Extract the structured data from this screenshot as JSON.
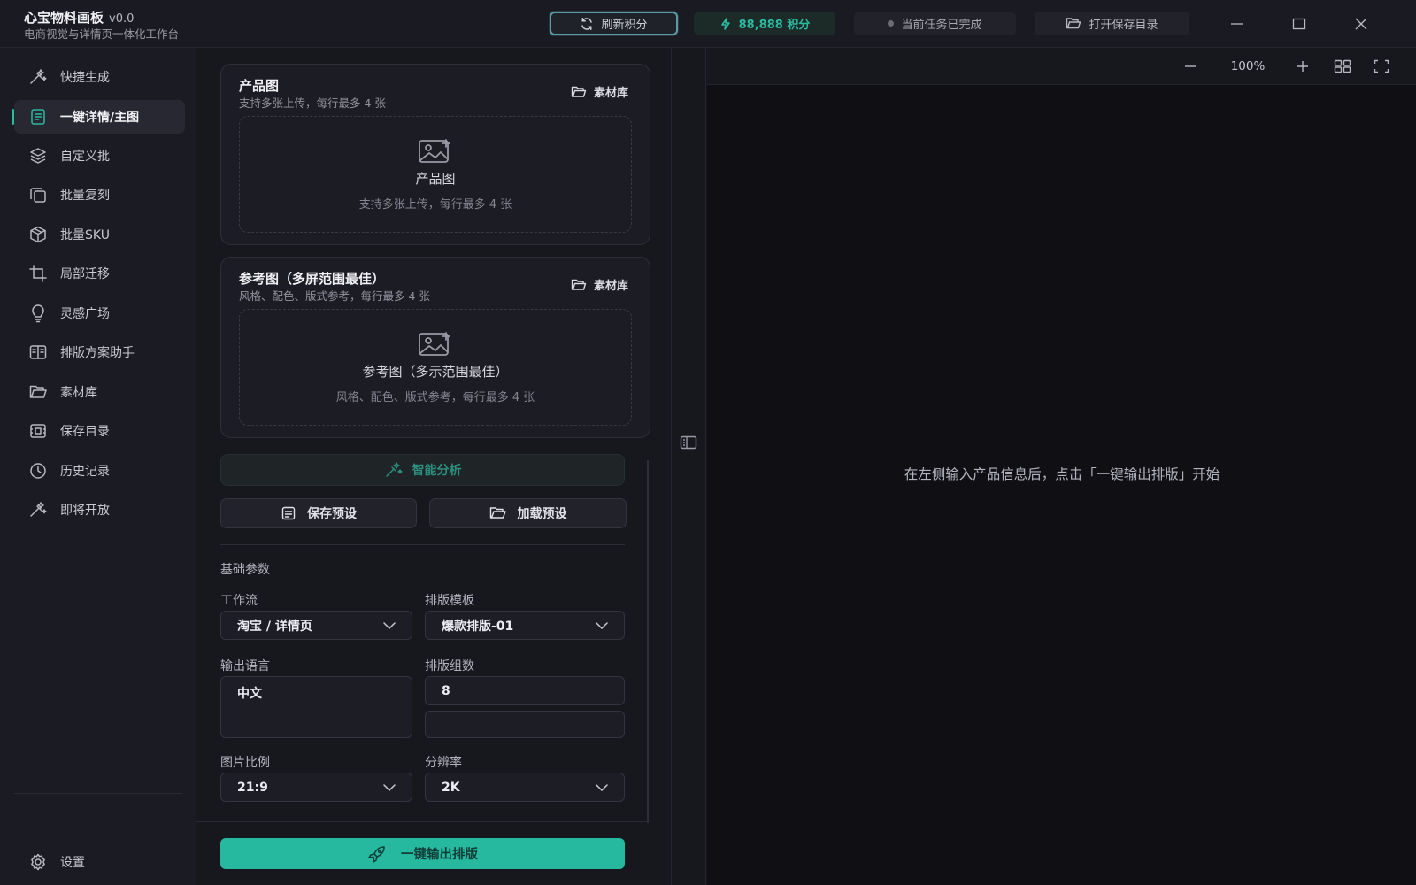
{
  "app": {
    "title": "心宝物料画板",
    "version": "v0.0",
    "subtitle": "电商视觉与详情页一体化工作台"
  },
  "titlebar": {
    "refresh_label": "刷新积分",
    "points_label": "88,888 积分",
    "status_label": "当前任务已完成",
    "open_dir_label": "打开保存目录"
  },
  "sidebar": {
    "items": [
      {
        "label": "快捷生成",
        "icon": "wand-icon"
      },
      {
        "label": "一键详情/主图",
        "icon": "document-icon",
        "active": true
      },
      {
        "label": "自定义批",
        "icon": "layers-icon"
      },
      {
        "label": "批量复刻",
        "icon": "copy-icon"
      },
      {
        "label": "批量SKU",
        "icon": "box-icon"
      },
      {
        "label": "局部迁移",
        "icon": "crop-icon"
      },
      {
        "label": "灵感广场",
        "icon": "lightbulb-icon"
      },
      {
        "label": "排版方案助手",
        "icon": "layout-icon"
      },
      {
        "label": "素材库",
        "icon": "folder-icon"
      },
      {
        "label": "保存目录",
        "icon": "save-dir-icon"
      },
      {
        "label": "历史记录",
        "icon": "clock-icon"
      },
      {
        "label": "即将开放",
        "icon": "sparkle-icon"
      }
    ],
    "settings_label": "设置"
  },
  "product_card": {
    "title": "产品图",
    "subtitle": "支持多张上传，每行最多 4 张",
    "library_label": "素材库",
    "drop_title": "产品图",
    "drop_sub": "支持多张上传，每行最多 4 张"
  },
  "reference_card": {
    "title": "参考图（多屏范围最佳）",
    "subtitle": "风格、配色、版式参考，每行最多 4 张",
    "library_label": "素材库",
    "drop_title": "参考图（多示范围最佳）",
    "drop_sub": "风格、配色、版式参考，每行最多 4 张"
  },
  "actions": {
    "analyze_label": "智能分析",
    "save_preset_label": "保存预设",
    "load_preset_label": "加载预设",
    "generate_label": "一键输出排版"
  },
  "params": {
    "section_label": "基础参数",
    "workflow": {
      "label": "工作流",
      "value": "淘宝 / 详情页"
    },
    "template": {
      "label": "排版模板",
      "value": "爆款排版-01"
    },
    "language": {
      "label": "输出语言",
      "value": "中文"
    },
    "groups": {
      "label": "排版组数",
      "value": "8"
    },
    "ratio": {
      "label": "图片比例",
      "value": "21:9"
    },
    "resolution": {
      "label": "分辨率",
      "value": "2K"
    }
  },
  "preview": {
    "zoom": "100%",
    "hint": "在左侧输入产品信息后，点击「一键输出排版」开始"
  },
  "colors": {
    "accent": "#27b8a0",
    "background": "#16161d",
    "preview_bg": "#0f0f14"
  }
}
